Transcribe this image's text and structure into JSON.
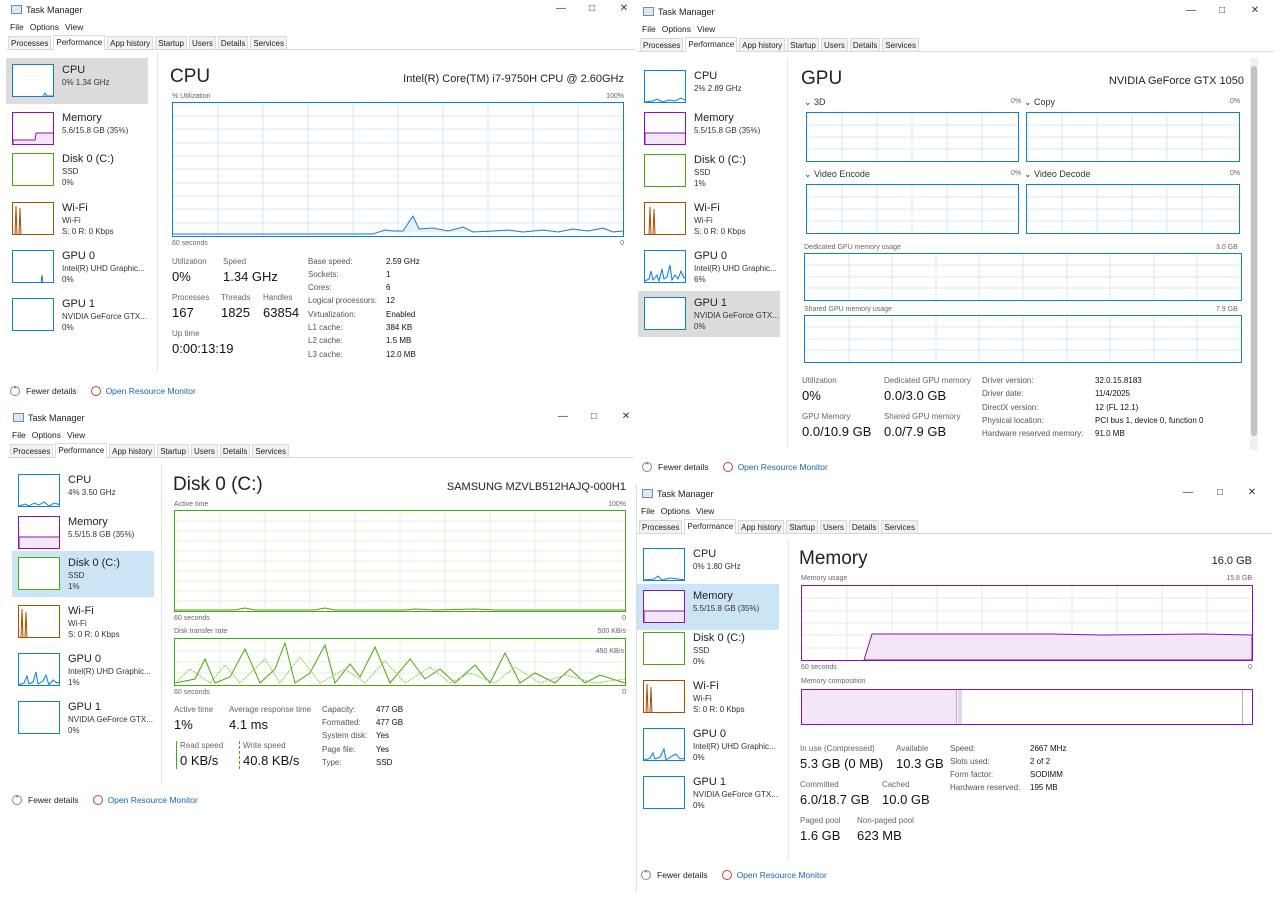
{
  "common": {
    "app_title": "Task Manager",
    "menu": [
      "File",
      "Options",
      "View"
    ],
    "tabs": [
      "Processes",
      "Performance",
      "App history",
      "Startup",
      "Users",
      "Details",
      "Services"
    ],
    "fewer_details": "Fewer details",
    "open_resource_monitor": "Open Resource Monitor",
    "minimize": "—",
    "maximize": "□",
    "close": "✕",
    "axis_60s": "60 seconds",
    "zero": "0",
    "hundred_pct": "100%"
  },
  "colors": {
    "cpu": "#1180d0",
    "memory": "#8b12ae",
    "disk": "#4da60c",
    "wifi": "#a74f01",
    "gpu": "#1180d0",
    "link": "#1a64b0"
  },
  "win_cpu": {
    "sidebar": [
      {
        "name": "CPU",
        "l1": "0%  1.34 GHz",
        "l2": ""
      },
      {
        "name": "Memory",
        "l1": "5.6/15.8 GB (35%)",
        "l2": ""
      },
      {
        "name": "Disk 0 (C:)",
        "l1": "SSD",
        "l2": "0%"
      },
      {
        "name": "Wi-Fi",
        "l1": "Wi-Fi",
        "l2": "S: 0  R: 0 Kbps"
      },
      {
        "name": "GPU 0",
        "l1": "Intel(R) UHD Graphic...",
        "l2": "0%"
      },
      {
        "name": "GPU 1",
        "l1": "NVIDIA GeForce GTX...",
        "l2": "0%"
      }
    ],
    "title": "CPU",
    "model": "Intel(R) Core(TM) i7-9750H CPU @ 2.60GHz",
    "graph_label": "% Utilization",
    "stats": {
      "utilization_label": "Utilization",
      "utilization": "0%",
      "speed_label": "Speed",
      "speed": "1.34 GHz",
      "processes_label": "Processes",
      "processes": "167",
      "threads_label": "Threads",
      "threads": "1825",
      "handles_label": "Handles",
      "handles": "63854",
      "uptime_label": "Up time",
      "uptime": "0:00:13:19"
    },
    "details": [
      {
        "k": "Base speed:",
        "v": "2.59 GHz"
      },
      {
        "k": "Sockets:",
        "v": "1"
      },
      {
        "k": "Cores:",
        "v": "6"
      },
      {
        "k": "Logical processors:",
        "v": "12"
      },
      {
        "k": "Virtualization:",
        "v": "Enabled"
      },
      {
        "k": "L1 cache:",
        "v": "384 KB"
      },
      {
        "k": "L2 cache:",
        "v": "1.5 MB"
      },
      {
        "k": "L3 cache:",
        "v": "12.0 MB"
      }
    ]
  },
  "win_gpu": {
    "sidebar": [
      {
        "name": "CPU",
        "l1": "2%  2.89 GHz",
        "l2": ""
      },
      {
        "name": "Memory",
        "l1": "5.5/15.8 GB (35%)",
        "l2": ""
      },
      {
        "name": "Disk 0 (C:)",
        "l1": "SSD",
        "l2": "1%"
      },
      {
        "name": "Wi-Fi",
        "l1": "Wi-Fi",
        "l2": "S: 0  R: 0 Kbps"
      },
      {
        "name": "GPU 0",
        "l1": "Intel(R) UHD Graphic...",
        "l2": "6%"
      },
      {
        "name": "GPU 1",
        "l1": "NVIDIA GeForce GTX...",
        "l2": "0%"
      }
    ],
    "title": "GPU",
    "model": "NVIDIA GeForce GTX 1050",
    "engines": [
      {
        "name": "3D",
        "pct": "0%"
      },
      {
        "name": "Copy",
        "pct": "0%"
      },
      {
        "name": "Video Encode",
        "pct": "0%"
      },
      {
        "name": "Video Decode",
        "pct": "0%"
      }
    ],
    "dedicated_label": "Dedicated GPU memory usage",
    "dedicated_max": "3.0 GB",
    "shared_label": "Shared GPU memory usage",
    "shared_max": "7.9 GB",
    "stats": {
      "utilization_label": "Utilization",
      "utilization": "0%",
      "dedicated_label": "Dedicated GPU memory",
      "dedicated": "0.0/3.0 GB",
      "gpumem_label": "GPU Memory",
      "gpumem": "0.0/10.9 GB",
      "shared_label": "Shared GPU memory",
      "shared": "0.0/7.9 GB"
    },
    "details": [
      {
        "k": "Driver version:",
        "v": "32.0.15.8183"
      },
      {
        "k": "Driver date:",
        "v": "11/4/2025"
      },
      {
        "k": "DirectX version:",
        "v": "12 (FL 12.1)"
      },
      {
        "k": "Physical location:",
        "v": "PCI bus 1, device 0, function 0"
      },
      {
        "k": "Hardware reserved memory:",
        "v": "91.0 MB"
      }
    ]
  },
  "win_disk": {
    "sidebar": [
      {
        "name": "CPU",
        "l1": "4%  3.50 GHz",
        "l2": ""
      },
      {
        "name": "Memory",
        "l1": "5.5/15.8 GB (35%)",
        "l2": ""
      },
      {
        "name": "Disk 0 (C:)",
        "l1": "SSD",
        "l2": "1%"
      },
      {
        "name": "Wi-Fi",
        "l1": "Wi-Fi",
        "l2": "S: 0  R: 0 Kbps"
      },
      {
        "name": "GPU 0",
        "l1": "Intel(R) UHD Graphic...",
        "l2": "1%"
      },
      {
        "name": "GPU 1",
        "l1": "NVIDIA GeForce GTX...",
        "l2": "0%"
      }
    ],
    "title": "Disk 0 (C:)",
    "model": "SAMSUNG MZVLB512HAJQ-000H1",
    "active_label": "Active time",
    "transfer_label": "Disk transfer rate",
    "transfer_max": "500 KB/s",
    "transfer_mid": "450 KB/s",
    "stats": {
      "active_label": "Active time",
      "active": "1%",
      "resp_label": "Average response time",
      "resp": "4.1 ms",
      "read_label": "Read speed",
      "read": "0 KB/s",
      "write_label": "Write speed",
      "write": "40.8 KB/s"
    },
    "details": [
      {
        "k": "Capacity:",
        "v": "477 GB"
      },
      {
        "k": "Formatted:",
        "v": "477 GB"
      },
      {
        "k": "System disk:",
        "v": "Yes"
      },
      {
        "k": "Page file:",
        "v": "Yes"
      },
      {
        "k": "Type:",
        "v": "SSD"
      }
    ]
  },
  "win_mem": {
    "sidebar": [
      {
        "name": "CPU",
        "l1": "0%  1.80 GHz",
        "l2": ""
      },
      {
        "name": "Memory",
        "l1": "5.5/15.8 GB (35%)",
        "l2": ""
      },
      {
        "name": "Disk 0 (C:)",
        "l1": "SSD",
        "l2": "0%"
      },
      {
        "name": "Wi-Fi",
        "l1": "Wi-Fi",
        "l2": "S: 0  R: 0 Kbps"
      },
      {
        "name": "GPU 0",
        "l1": "Intel(R) UHD Graphic...",
        "l2": "0%"
      },
      {
        "name": "GPU 1",
        "l1": "NVIDIA GeForce GTX...",
        "l2": "0%"
      }
    ],
    "title": "Memory",
    "total": "16.0 GB",
    "usage_label": "Memory usage",
    "usage_max": "15.8 GB",
    "composition_label": "Memory composition",
    "stats": {
      "inuse_label": "In use (Compressed)",
      "inuse": "5.3 GB (0 MB)",
      "avail_label": "Available",
      "avail": "10.3 GB",
      "committed_label": "Committed",
      "committed": "6.0/18.7 GB",
      "cached_label": "Cached",
      "cached": "10.0 GB",
      "paged_label": "Paged pool",
      "paged": "1.6 GB",
      "nonpaged_label": "Non-paged pool",
      "nonpaged": "623 MB"
    },
    "details": [
      {
        "k": "Speed:",
        "v": "2667 MHz"
      },
      {
        "k": "Slots used:",
        "v": "2 of 2"
      },
      {
        "k": "Form factor:",
        "v": "SODIMM"
      },
      {
        "k": "Hardware reserved:",
        "v": "195 MB"
      }
    ]
  }
}
